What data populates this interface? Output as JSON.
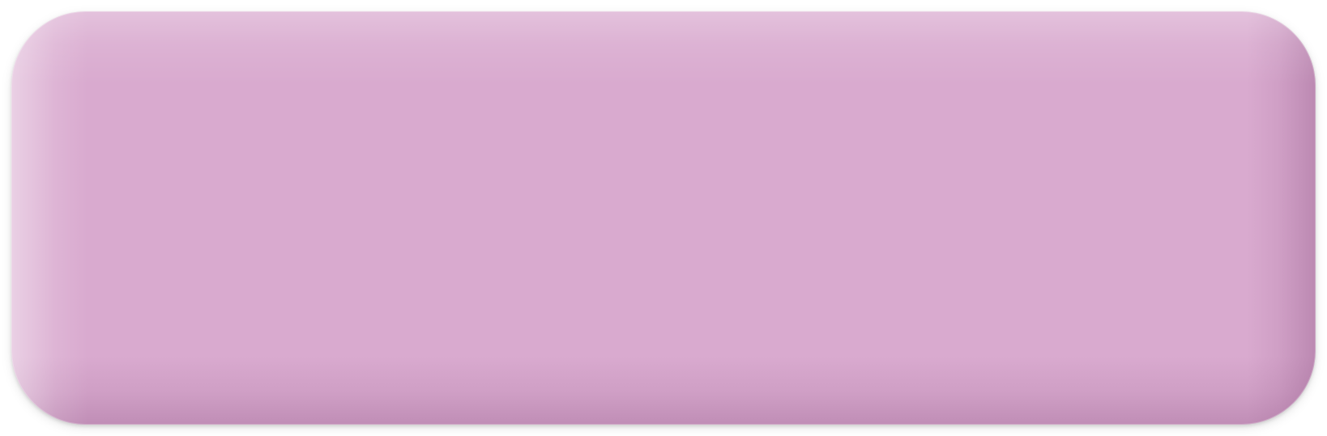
{
  "button": {
    "label": "",
    "color": "#d9aacf"
  }
}
